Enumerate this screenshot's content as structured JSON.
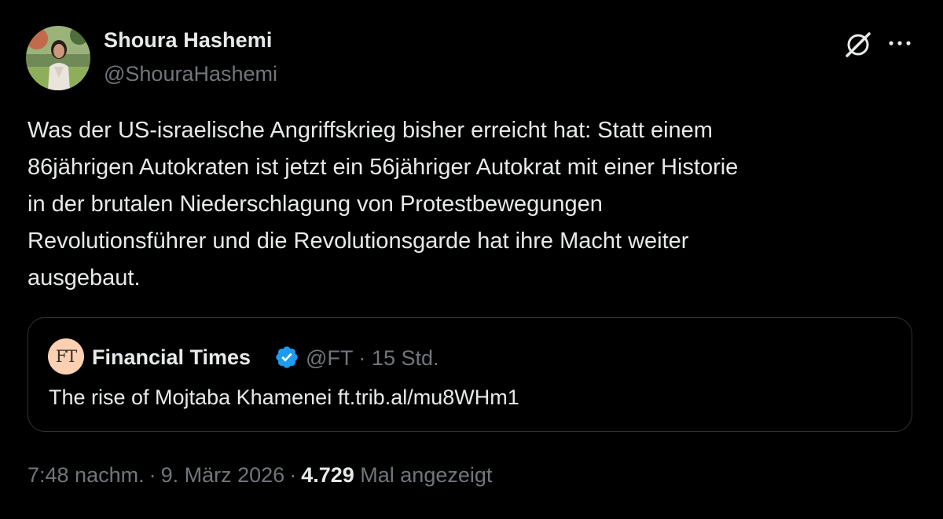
{
  "author": {
    "name": "Shoura Hashemi",
    "handle": "@ShouraHashemi"
  },
  "actions": {
    "grok_icon": "grok-icon",
    "more_icon": "more-icon",
    "more_label": "···"
  },
  "tweet": {
    "lines": [
      "Was der US-israelische Angriffskrieg bisher erreicht hat: Statt einem",
      "86jährigen Autokraten ist jetzt ein 56jähriger Autokrat mit einer Historie",
      "in der brutalen Niederschlagung von Protestbewegungen",
      "Revolutionsführer und die Revolutionsgarde hat ihre Macht weiter",
      "ausgebaut."
    ]
  },
  "quote": {
    "logo_text": "FT",
    "name": "Financial Times",
    "handle": "@FT",
    "separator": "·",
    "time": "15 Std.",
    "text": "The rise of Mojtaba Khamenei ft.trib.al/mu8WHm1",
    "verified_color": "#1d9bf0"
  },
  "footer": {
    "time": "7:48 nachm.",
    "separator": "·",
    "date": "9. März 2026",
    "views_count": "4.729",
    "views_label": "Mal angezeigt"
  },
  "colors": {
    "background": "#000000",
    "text": "#e7e9ea",
    "muted": "#71767b",
    "border": "#2f3336",
    "ft_logo_bg": "#fcd0b1"
  }
}
